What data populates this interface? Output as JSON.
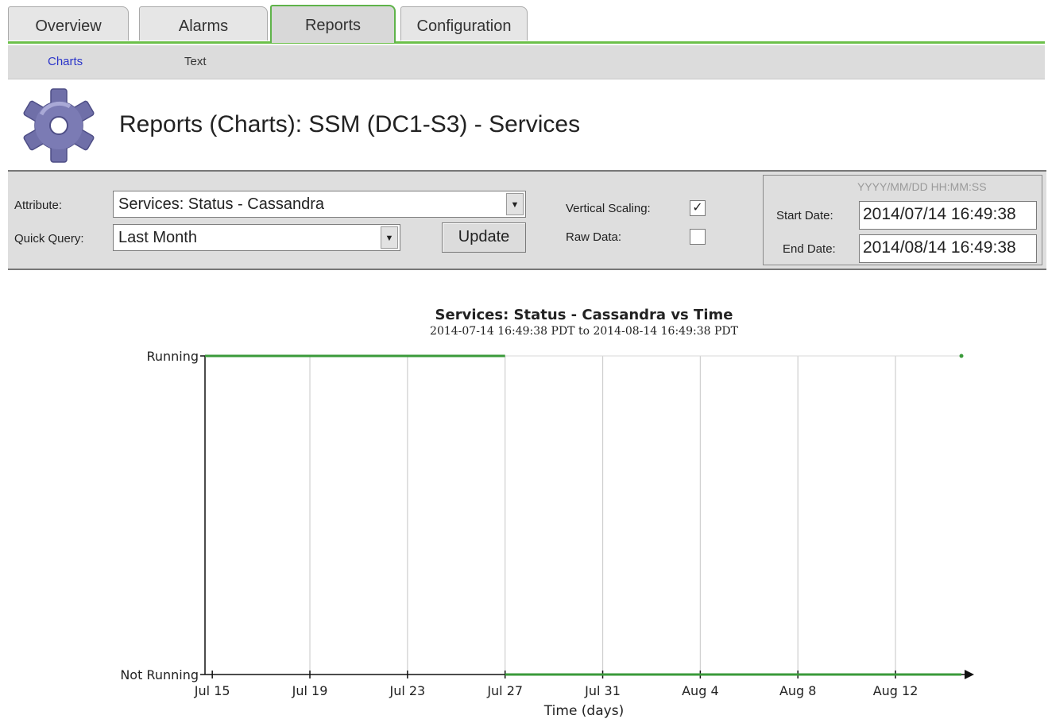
{
  "tabs": [
    "Overview",
    "Alarms",
    "Reports",
    "Configuration"
  ],
  "active_tab": "Reports",
  "subtabs": [
    "Charts",
    "Text"
  ],
  "active_subtab": "Charts",
  "page_title": "Reports (Charts): SSM (DC1-S3) - Services",
  "form": {
    "attribute_label": "Attribute:",
    "attribute_value": "Services: Status - Cassandra",
    "quick_query_label": "Quick Query:",
    "quick_query_value": "Last Month",
    "update_label": "Update",
    "vertical_scaling_label": "Vertical Scaling:",
    "vertical_scaling_checked": true,
    "raw_data_label": "Raw Data:",
    "raw_data_checked": false,
    "date_format_hint": "YYYY/MM/DD HH:MM:SS",
    "start_date_label": "Start Date:",
    "start_date_value": "2014/07/14 16:49:38",
    "end_date_label": "End Date:",
    "end_date_value": "2014/08/14 16:49:38"
  },
  "icons": {
    "check": "✓",
    "select_arrow": "▼"
  },
  "colors": {
    "accent_green": "#6cc04a",
    "series_green": "#3a9a3a",
    "gear": "#6f6fa8",
    "link_blue": "#2b35c9"
  },
  "chart_data": {
    "type": "line",
    "title": "Services: Status - Cassandra vs Time",
    "subtitle": "2014-07-14 16:49:38 PDT to 2014-08-14 16:49:38 PDT",
    "xlabel": "Time (days)",
    "x_ticks": [
      "Jul 15",
      "Jul 19",
      "Jul 23",
      "Jul 27",
      "Jul 31",
      "Aug 4",
      "Aug 8",
      "Aug 12"
    ],
    "y_ticks": [
      "Not Running",
      "Running"
    ],
    "xlim": [
      "2014-07-14 16:49:38",
      "2014-08-14 16:49:38"
    ],
    "grid": true,
    "series": [
      {
        "points": [
          {
            "x": "2014-07-14 16:49:38",
            "y": "Running"
          },
          {
            "x": "2014-07-27 00:00:00",
            "y": "Running"
          },
          {
            "x": "2014-07-27 00:00:00",
            "y": "Not Running"
          },
          {
            "x": "2014-08-14 16:49:38",
            "y": "Not Running"
          }
        ]
      }
    ],
    "markers": [
      {
        "x": "2014-08-14 16:49:38",
        "y": "Running"
      }
    ]
  }
}
